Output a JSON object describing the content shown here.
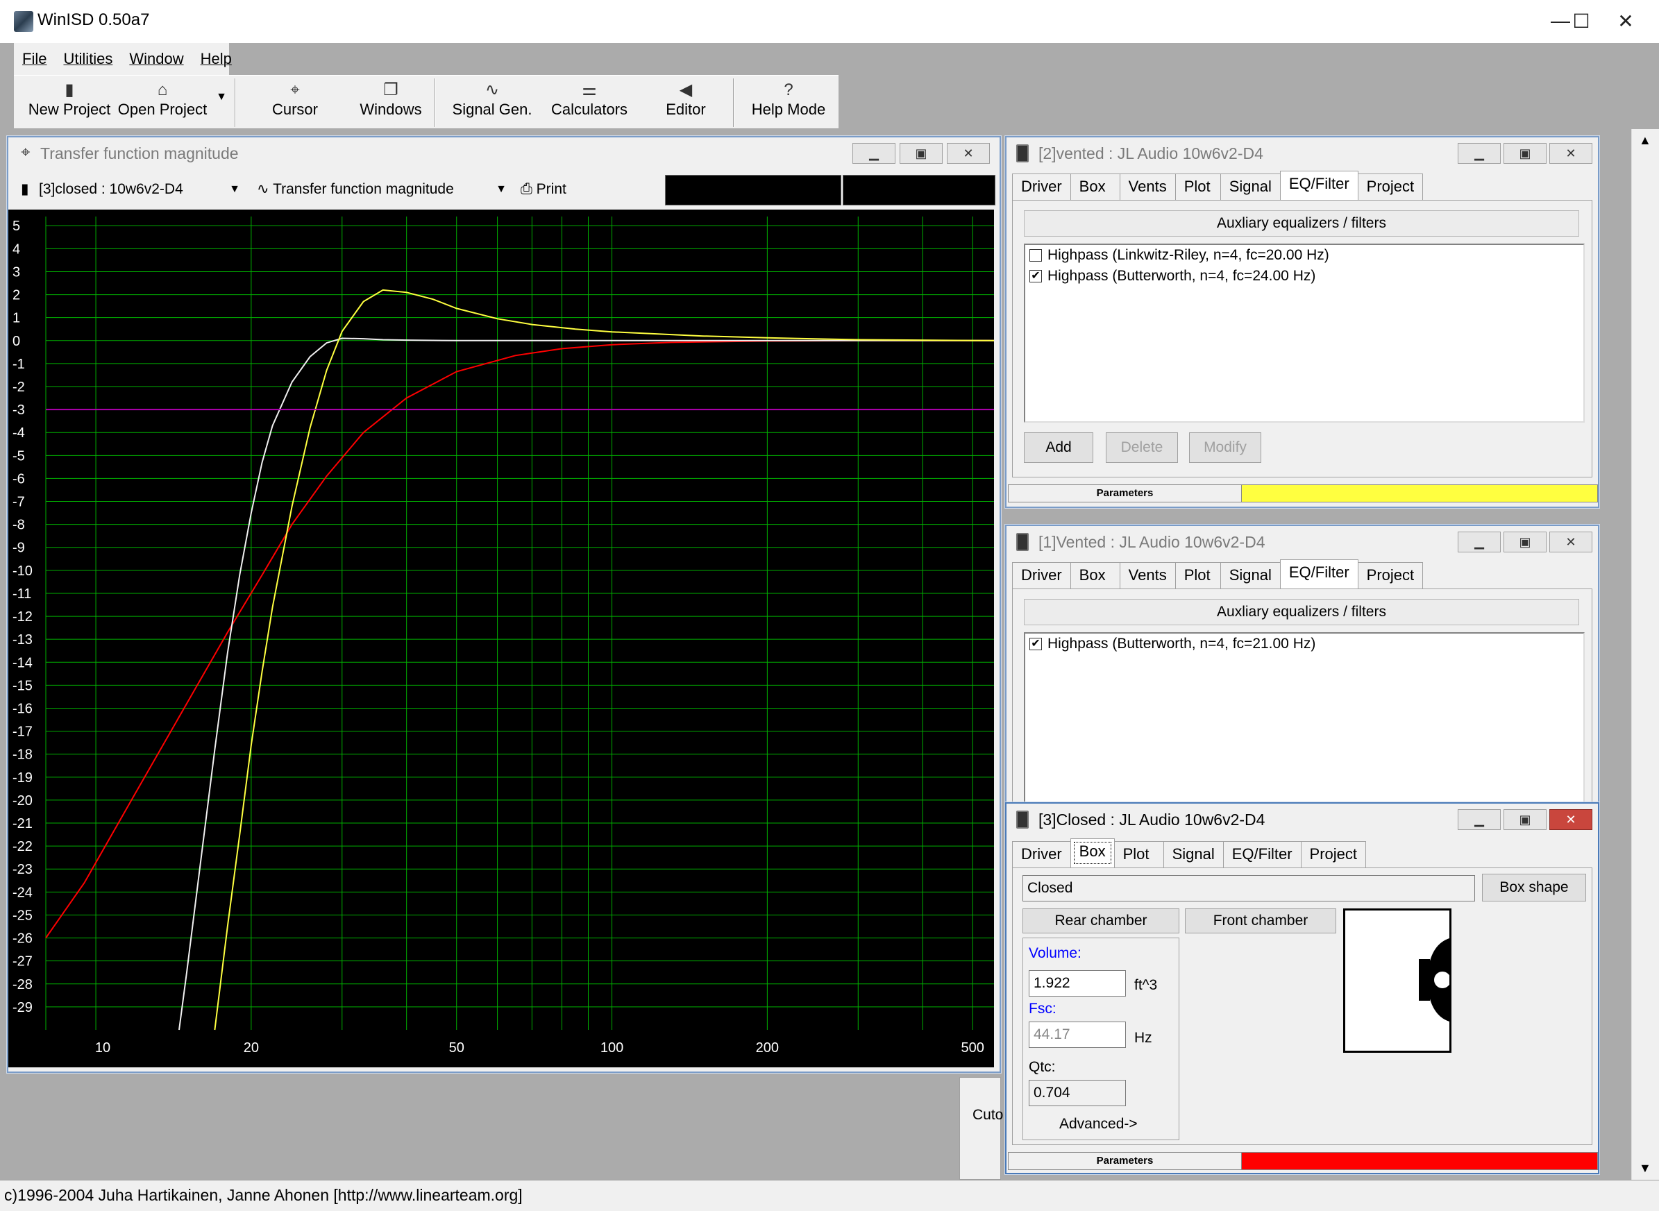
{
  "app": {
    "title": "WinISD 0.50a7",
    "window_controls": {
      "minimize": "—",
      "maximize": "☐",
      "close": "✕"
    }
  },
  "menu": [
    {
      "label": "File"
    },
    {
      "label": "Utilities"
    },
    {
      "label": "Window"
    },
    {
      "label": "Help"
    }
  ],
  "toolbar": {
    "new_project": "New Project",
    "open_project": "Open Project",
    "cursor": "Cursor",
    "windows": "Windows",
    "signal_gen": "Signal Gen.",
    "calculators": "Calculators",
    "editor": "Editor",
    "help_mode": "Help Mode"
  },
  "status": {
    "text": "c)1996-2004 Juha Hartikainen, Janne Ahonen [http://www.linearteam.org]",
    "partial_label": "Cuto"
  },
  "plot_window": {
    "title": "Transfer function magnitude",
    "project_select": "[3]closed : 10w6v2-D4",
    "plot_select": "Transfer function magnitude",
    "print": "Print"
  },
  "chart_data": {
    "type": "line",
    "title": "",
    "xlabel": "",
    "ylabel": "",
    "x_scale": "log",
    "xlim": [
      8,
      550
    ],
    "ylim": [
      -30,
      6
    ],
    "x_ticks": [
      10,
      20,
      50,
      100,
      200,
      500
    ],
    "y_ticks": [
      5,
      4,
      3,
      2,
      1,
      0,
      -1,
      -2,
      -3,
      -4,
      -5,
      -6,
      -7,
      -8,
      -9,
      -10,
      -11,
      -12,
      -13,
      -14,
      -15,
      -16,
      -17,
      -18,
      -19,
      -20,
      -21,
      -22,
      -23,
      -24,
      -25,
      -26,
      -27,
      -28,
      -29
    ],
    "grid": true,
    "grid_color": "#00b000",
    "background": "#000000",
    "series": [
      {
        "color": "#ff0000",
        "x": [
          8,
          9.5,
          12,
          15,
          18,
          21,
          24,
          28,
          33,
          40,
          50,
          65,
          80,
          100,
          130,
          200,
          300,
          550
        ],
        "y": [
          -26,
          -23.6,
          -19.6,
          -15.8,
          -12.7,
          -10.2,
          -8.0,
          -5.9,
          -4.0,
          -2.5,
          -1.35,
          -0.65,
          -0.35,
          -0.18,
          -0.08,
          -0.02,
          0,
          0
        ]
      },
      {
        "color": "#f0f0f0",
        "x": [
          14.5,
          15,
          16,
          17,
          18,
          19,
          20,
          21,
          22,
          24,
          26,
          28,
          30,
          33,
          36,
          40,
          50,
          70,
          100,
          200,
          550
        ],
        "y": [
          -30,
          -27.5,
          -22.5,
          -17.8,
          -13.6,
          -10.2,
          -7.5,
          -5.3,
          -3.7,
          -1.8,
          -0.7,
          -0.1,
          0.1,
          0.08,
          0.04,
          0.02,
          0,
          0,
          0,
          0,
          0
        ]
      },
      {
        "color": "#ffff40",
        "x": [
          17,
          18,
          19,
          20,
          21,
          22,
          24,
          26,
          28,
          30,
          33,
          36,
          40,
          45,
          50,
          60,
          70,
          85,
          100,
          150,
          200,
          300,
          550
        ],
        "y": [
          -30,
          -25.5,
          -21.5,
          -17.6,
          -14.4,
          -11.6,
          -7.2,
          -3.8,
          -1.3,
          0.4,
          1.7,
          2.2,
          2.1,
          1.8,
          1.4,
          0.95,
          0.7,
          0.5,
          0.38,
          0.2,
          0.12,
          0.04,
          0
        ]
      },
      {
        "color": "#b000b0",
        "x": [
          8,
          550
        ],
        "y": [
          -3,
          -3
        ]
      }
    ]
  },
  "win_vented2": {
    "title": "[2]vented : JL Audio 10w6v2-D4",
    "tabs": [
      "Driver",
      "Box",
      "Vents",
      "Plot",
      "Signal",
      "EQ/Filter",
      "Project"
    ],
    "selected_tab": "EQ/Filter",
    "header": "Auxliary equalizers / filters",
    "filters": [
      {
        "checked": false,
        "label": "Highpass (Linkwitz-Riley, n=4, fc=20.00 Hz)"
      },
      {
        "checked": true,
        "label": "Highpass (Butterworth, n=4, fc=24.00 Hz)"
      }
    ],
    "buttons": {
      "add": "Add",
      "delete": "Delete",
      "modify": "Modify"
    },
    "params_label": "Parameters",
    "params_color": "#ffff40"
  },
  "win_vented1": {
    "title": "[1]Vented : JL Audio 10w6v2-D4",
    "tabs": [
      "Driver",
      "Box",
      "Vents",
      "Plot",
      "Signal",
      "EQ/Filter",
      "Project"
    ],
    "selected_tab": "EQ/Filter",
    "header": "Auxliary equalizers / filters",
    "filters": [
      {
        "checked": true,
        "label": "Highpass (Butterworth, n=4, fc=21.00 Hz)"
      }
    ]
  },
  "win_closed3": {
    "title": "[3]Closed : JL Audio 10w6v2-D4",
    "tabs": [
      "Driver",
      "Box",
      "Plot",
      "Signal",
      "EQ/Filter",
      "Project"
    ],
    "selected_tab": "Box",
    "box_type": "Closed",
    "box_shape_btn": "Box shape",
    "rear_chamber_btn": "Rear chamber",
    "front_chamber_btn": "Front chamber",
    "volume_label": "Volume:",
    "volume_value": "1.922",
    "volume_unit": "ft^3",
    "fsc_label": "Fsc:",
    "fsc_value": "44.17",
    "fsc_unit": "Hz",
    "qtc_label": "Qtc:",
    "qtc_value": "0.704",
    "advanced_btn": "Advanced->",
    "params_label": "Parameters",
    "params_color": "#ff0000"
  }
}
